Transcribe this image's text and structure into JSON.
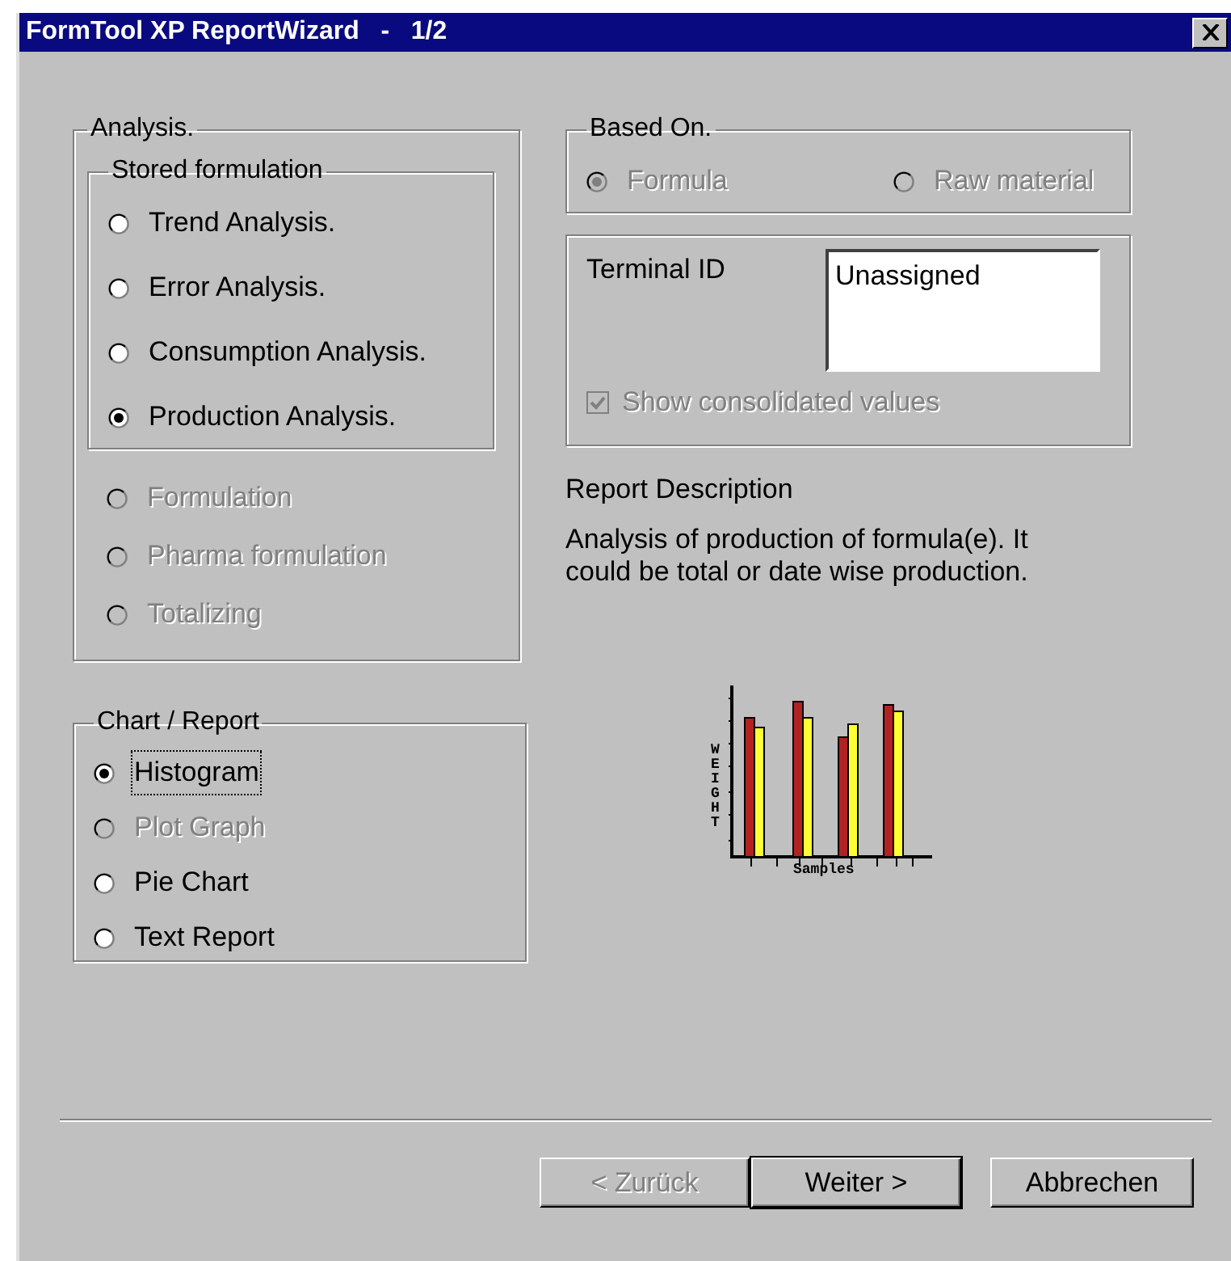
{
  "window": {
    "title": "FormTool XP ReportWizard   -   1/2"
  },
  "analysis": {
    "label": "Analysis.",
    "stored": {
      "label": "Stored formulation",
      "options": [
        {
          "label": "Trend Analysis.",
          "selected": false,
          "disabled": false
        },
        {
          "label": "Error Analysis.",
          "selected": false,
          "disabled": false
        },
        {
          "label": "Consumption Analysis.",
          "selected": false,
          "disabled": false
        },
        {
          "label": "Production Analysis.",
          "selected": true,
          "disabled": false
        }
      ]
    },
    "options": [
      {
        "label": "Formulation",
        "selected": false,
        "disabled": true
      },
      {
        "label": "Pharma formulation",
        "selected": false,
        "disabled": true
      },
      {
        "label": "Totalizing",
        "selected": false,
        "disabled": true
      }
    ]
  },
  "chart_report": {
    "label": "Chart / Report",
    "options": [
      {
        "label": "Histogram",
        "selected": true,
        "disabled": false,
        "focused": true
      },
      {
        "label": "Plot Graph",
        "selected": false,
        "disabled": true,
        "focused": false
      },
      {
        "label": "Pie Chart",
        "selected": false,
        "disabled": false,
        "focused": false
      },
      {
        "label": "Text Report",
        "selected": false,
        "disabled": false,
        "focused": false
      }
    ]
  },
  "based_on": {
    "label": "Based On.",
    "options": [
      {
        "label": "Formula",
        "selected": true,
        "disabled": true
      },
      {
        "label": "Raw material",
        "selected": false,
        "disabled": true
      }
    ]
  },
  "terminal": {
    "label": "Terminal ID",
    "value": "Unassigned",
    "show_consolidated": {
      "label": "Show consolidated values",
      "checked": true,
      "disabled": true
    }
  },
  "report_description": {
    "label": "Report Description",
    "text": "Analysis of production of formula(e). It could be total  or date wise production."
  },
  "preview": {
    "ylabel": "WEIGHT",
    "xlabel": "Samples"
  },
  "buttons": [
    {
      "label": "< Zurück",
      "disabled": true,
      "default": false
    },
    {
      "label": "Weiter >",
      "disabled": false,
      "default": true
    },
    {
      "label": "Abbrechen",
      "disabled": false,
      "default": false
    }
  ]
}
